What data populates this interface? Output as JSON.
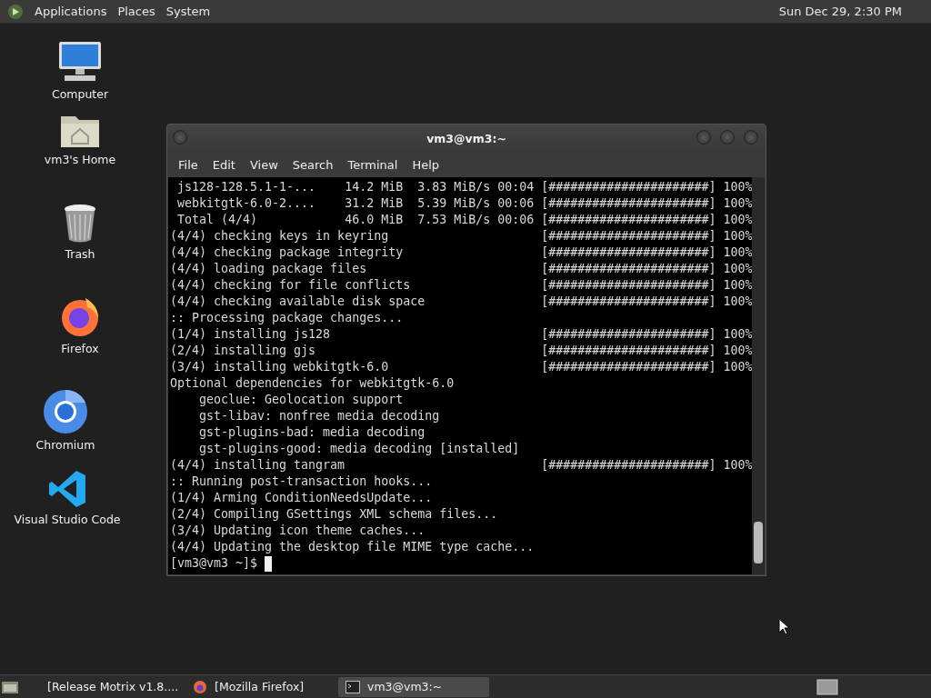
{
  "top_panel": {
    "menus": [
      "Applications",
      "Places",
      "System"
    ],
    "clock": "Sun Dec 29,  2:30 PM"
  },
  "desktop_icons": [
    {
      "label": "Computer",
      "kind": "computer"
    },
    {
      "label": "vm3's Home",
      "kind": "home"
    },
    {
      "label": "Trash",
      "kind": "trash"
    },
    {
      "label": "Firefox",
      "kind": "firefox"
    },
    {
      "label": "Chromium",
      "kind": "chromium"
    },
    {
      "label": "Visual Studio Code",
      "kind": "vscode"
    }
  ],
  "terminal": {
    "title": "vm3@vm3:~",
    "menu": [
      "File",
      "Edit",
      "View",
      "Search",
      "Terminal",
      "Help"
    ],
    "lines": [
      " js128-128.5.1-1-...    14.2 MiB  3.83 MiB/s 00:04 [######################] 100%",
      " webkitgtk-6.0-2....    31.2 MiB  5.39 MiB/s 00:06 [######################] 100%",
      " Total (4/4)            46.0 MiB  7.53 MiB/s 00:06 [######################] 100%",
      "(4/4) checking keys in keyring                     [######################] 100%",
      "(4/4) checking package integrity                   [######################] 100%",
      "(4/4) loading package files                        [######################] 100%",
      "(4/4) checking for file conflicts                  [######################] 100%",
      "(4/4) checking available disk space                [######################] 100%",
      ":: Processing package changes...",
      "(1/4) installing js128                             [######################] 100%",
      "(2/4) installing gjs                               [######################] 100%",
      "(3/4) installing webkitgtk-6.0                     [######################] 100%",
      "Optional dependencies for webkitgtk-6.0",
      "    geoclue: Geolocation support",
      "    gst-libav: nonfree media decoding",
      "    gst-plugins-bad: media decoding",
      "    gst-plugins-good: media decoding [installed]",
      "(4/4) installing tangram                           [######################] 100%",
      ":: Running post-transaction hooks...",
      "(1/4) Arming ConditionNeedsUpdate...",
      "(2/4) Compiling GSettings XML schema files...",
      "(3/4) Updating icon theme caches...",
      "(4/4) Updating the desktop file MIME type cache..."
    ],
    "prompt": "[vm3@vm3 ~]$"
  },
  "taskbar": {
    "items": [
      {
        "label": "[Release Motrix v1.8....",
        "kind": "browser",
        "selected": false
      },
      {
        "label": "[Mozilla Firefox]",
        "kind": "browser",
        "selected": false
      },
      {
        "label": "vm3@vm3:~",
        "kind": "terminal",
        "selected": true
      }
    ]
  }
}
